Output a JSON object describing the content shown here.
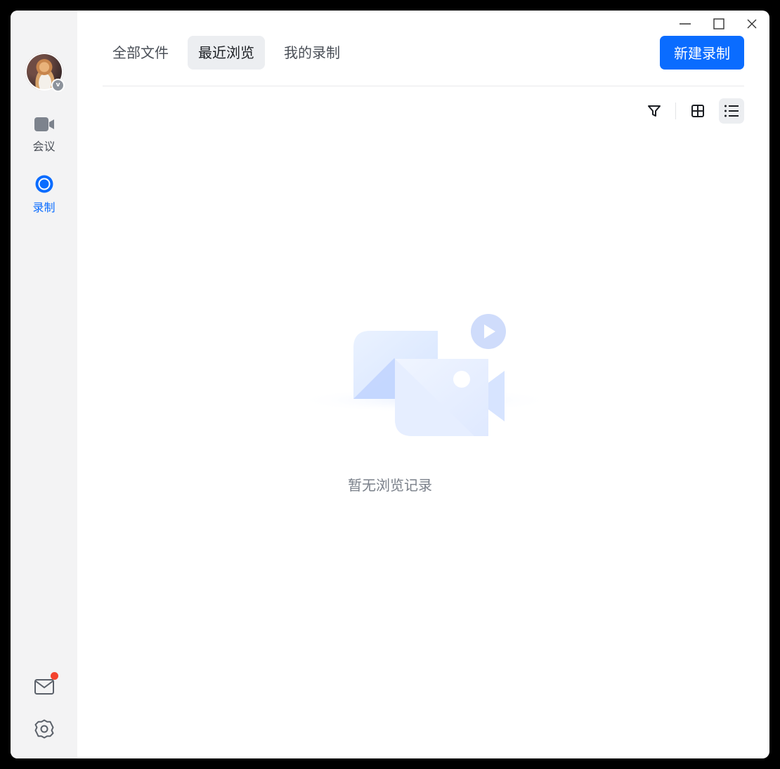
{
  "window_controls": {
    "minimize": "minimize",
    "maximize": "maximize",
    "close": "close"
  },
  "sidebar": {
    "items": [
      {
        "label": "会议",
        "icon": "video-camera-icon"
      },
      {
        "label": "录制",
        "icon": "record-icon"
      }
    ],
    "avatar_badge": "v"
  },
  "tabs": [
    {
      "label": "全部文件"
    },
    {
      "label": "最近浏览"
    },
    {
      "label": "我的录制"
    }
  ],
  "active_tab_index": 1,
  "toolbar": {
    "new_recording_label": "新建录制"
  },
  "empty_state": {
    "message": "暂无浏览记录"
  },
  "colors": {
    "accent": "#0a6cff",
    "sidebar_bg": "#f3f3f4",
    "notification_dot": "#f4432e"
  }
}
